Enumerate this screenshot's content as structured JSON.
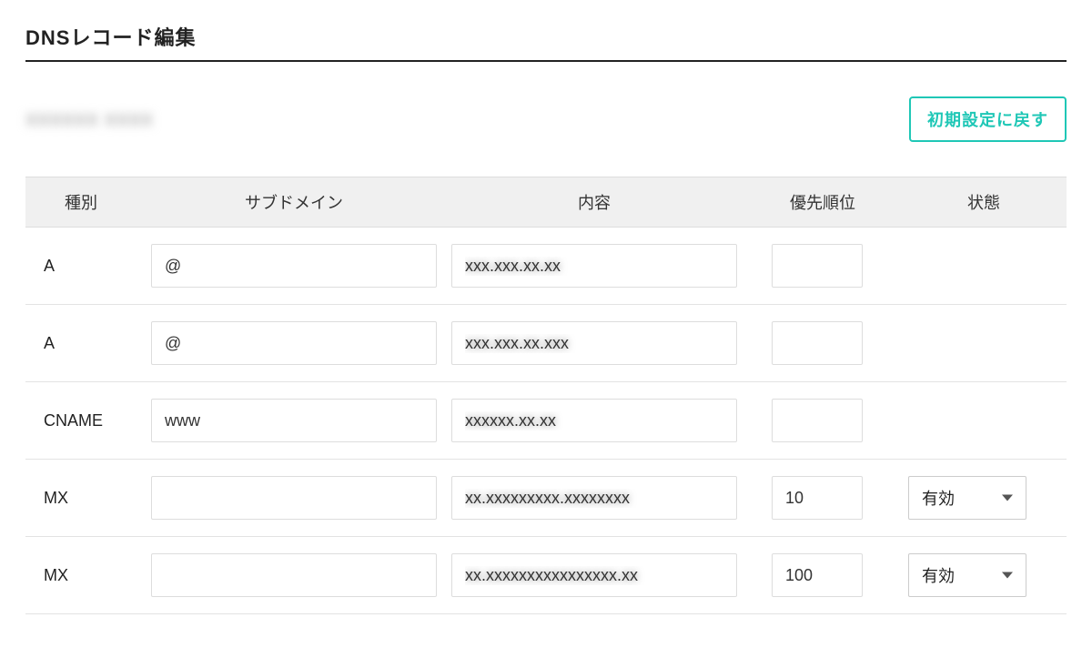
{
  "page": {
    "title": "DNSレコード編集",
    "domain_display": "xxxxxx xxxx",
    "reset_label": "初期設定に戻す"
  },
  "table": {
    "headers": {
      "type": "種別",
      "subdomain": "サブドメイン",
      "content": "内容",
      "priority": "優先順位",
      "status": "状態"
    },
    "rows": [
      {
        "type": "A",
        "subdomain": "@",
        "content": "xxx.xxx.xx.xx",
        "content_blurred": true,
        "priority": "",
        "status": ""
      },
      {
        "type": "A",
        "subdomain": "@",
        "content": "xxx.xxx.xx.xxx",
        "content_blurred": true,
        "priority": "",
        "status": ""
      },
      {
        "type": "CNAME",
        "subdomain": "www",
        "content": "xxxxxx.xx.xx",
        "content_blurred": true,
        "priority": "",
        "status": ""
      },
      {
        "type": "MX",
        "subdomain": "",
        "content": "xx.xxxxxxxxx.xxxxxxxx",
        "content_blurred": true,
        "priority": "10",
        "status": "有効"
      },
      {
        "type": "MX",
        "subdomain": "",
        "content": "xx.xxxxxxxxxxxxxxxx.xx",
        "content_blurred": true,
        "priority": "100",
        "status": "有効"
      }
    ]
  }
}
